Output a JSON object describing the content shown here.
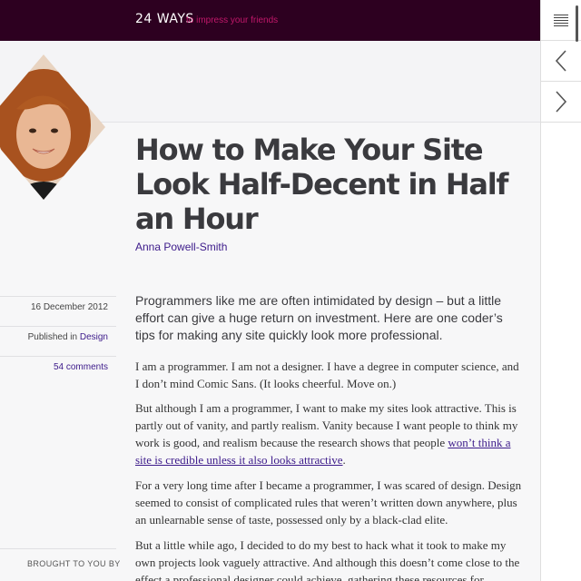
{
  "header": {
    "brand": "24 WAYS",
    "tagline": "to impress your friends"
  },
  "nav": {
    "menu_icon": "hamburger-icon",
    "prev_icon": "chevron-left-icon",
    "next_icon": "chevron-right-icon"
  },
  "article": {
    "title": "How to Make Your Site Look Half-Decent in Half an Hour",
    "author": "Anna Powell-Smith",
    "date": "16 December 2012",
    "published_prefix": "Published in",
    "category": "Design",
    "comments": "54 comments",
    "lead": "Programmers like me are often intimidated by design – but a little effort can give a huge return on investment. Here are one coder’s tips for making any site quickly look more professional.",
    "paragraphs": [
      "I am a programmer. I am not a designer. I have a degree in computer science, and I don’t mind Comic Sans. (It looks cheerful. Move on.)",
      "For a very long time after I became a programmer, I was scared of design. Design seemed to consist of complicated rules that weren’t written down anywhere, plus an unlearnable sense of taste, possessed only by a black-clad elite.",
      "But a little while ago, I decided to do my best to hack what it took to make my own projects look vaguely attractive. And although this doesn’t come close to the effect a professional designer could achieve, gathering these resources for"
    ],
    "p2_before": "But although I am a programmer, I want to make my sites look attractive. This is partly out of vanity, and partly realism. Vanity because I want people to think my work is good, and realism because the research shows that people ",
    "p2_link": "won’t think a site is credible unless it also looks attractive",
    "p2_after": "."
  },
  "sidebar": {
    "brought": "BROUGHT TO YOU BY"
  },
  "colors": {
    "header_bg": "#2d0020",
    "tagline": "#c0176a",
    "link": "#3c1a8a"
  }
}
